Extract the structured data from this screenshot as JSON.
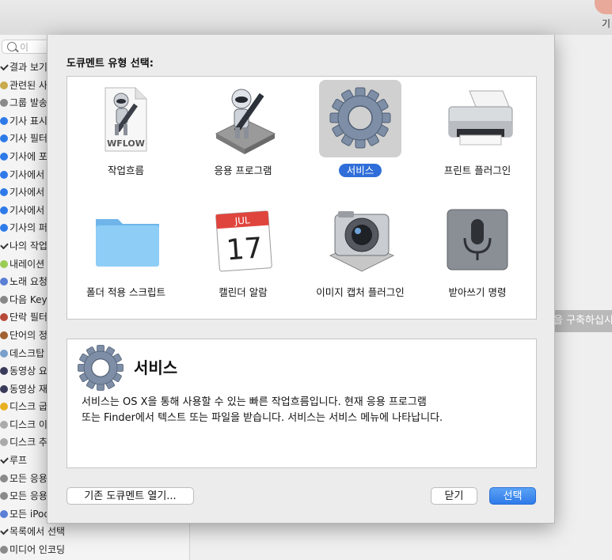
{
  "window": {
    "user_label": "기",
    "search_placeholder": "이",
    "tooltip_text": "을 구축하십시"
  },
  "sidebar": {
    "items": [
      {
        "label": "결과 보기",
        "icon": "check-icon",
        "color": "#333333"
      },
      {
        "label": "관련된 사",
        "icon": "action-icon",
        "color": "#c9a94b"
      },
      {
        "label": "그룹 발송",
        "icon": "action-icon",
        "color": "#8a8a8a"
      },
      {
        "label": "기사 표시",
        "icon": "rss-icon",
        "color": "#2f7ae9"
      },
      {
        "label": "기사 필터",
        "icon": "rss-icon",
        "color": "#2f7ae9"
      },
      {
        "label": "기사에 포",
        "icon": "rss-icon",
        "color": "#2f7ae9"
      },
      {
        "label": "기사에서",
        "icon": "rss-icon",
        "color": "#2f7ae9"
      },
      {
        "label": "기사에서",
        "icon": "rss-icon",
        "color": "#2f7ae9"
      },
      {
        "label": "기사에서",
        "icon": "rss-icon",
        "color": "#2f7ae9"
      },
      {
        "label": "기사의 퍼",
        "icon": "rss-icon",
        "color": "#2f7ae9"
      },
      {
        "label": "나의 작업",
        "icon": "check-icon",
        "color": "#333333"
      },
      {
        "label": "내레이션",
        "icon": "action-icon",
        "color": "#9acd55"
      },
      {
        "label": "노래 요청",
        "icon": "action-icon",
        "color": "#5a7fd6"
      },
      {
        "label": "다음 Key",
        "icon": "action-icon",
        "color": "#888888"
      },
      {
        "label": "단락 필터",
        "icon": "action-icon",
        "color": "#b84a3a"
      },
      {
        "label": "단어의 정",
        "icon": "action-icon",
        "color": "#a06030"
      },
      {
        "label": "데스크탑",
        "icon": "action-icon",
        "color": "#7aa0cc"
      },
      {
        "label": "동영상 요",
        "icon": "action-icon",
        "color": "#3a3a5a"
      },
      {
        "label": "동영상 재",
        "icon": "action-icon",
        "color": "#3a3a5a"
      },
      {
        "label": "디스크 굽",
        "icon": "action-icon",
        "color": "#e8b020"
      },
      {
        "label": "디스크 이",
        "icon": "action-icon",
        "color": "#aaaaaa"
      },
      {
        "label": "디스크 추",
        "icon": "action-icon",
        "color": "#aaaaaa"
      },
      {
        "label": "루프",
        "icon": "check-icon",
        "color": "#333333"
      },
      {
        "label": "모든 응용",
        "icon": "action-icon",
        "color": "#8a8a8a"
      },
      {
        "label": "모든 응용",
        "icon": "action-icon",
        "color": "#8a8a8a"
      },
      {
        "label": "모든 iPod",
        "icon": "action-icon",
        "color": "#5a7fd6"
      },
      {
        "label": "목록에서 선택",
        "icon": "check-icon",
        "color": "#333333"
      },
      {
        "label": "미디어 인코딩",
        "icon": "action-icon",
        "color": "#8a8a8a"
      }
    ]
  },
  "dialog": {
    "heading": "도큐멘트 유형 선택:",
    "types": [
      {
        "label": "작업흐름",
        "icon": "workflow-document-icon",
        "badge": "WFLOW",
        "selected": false
      },
      {
        "label": "응용 프로그램",
        "icon": "automator-robot-icon",
        "selected": false
      },
      {
        "label": "서비스",
        "icon": "gear-icon",
        "selected": true
      },
      {
        "label": "프린트 플러그인",
        "icon": "printer-icon",
        "selected": false
      },
      {
        "label": "폴더 적용 스크립트",
        "icon": "folder-icon",
        "selected": false
      },
      {
        "label": "캘린더 알람",
        "icon": "calendar-icon",
        "month": "JUL",
        "day": "17",
        "selected": false
      },
      {
        "label": "이미지 캡처 플러그인",
        "icon": "camera-icon",
        "selected": false
      },
      {
        "label": "받아쓰기 명령",
        "icon": "microphone-icon",
        "selected": false
      }
    ],
    "description": {
      "title": "서비스",
      "line1": "서비스는 OS X을 통해 사용할 수 있는 빠른 작업흐름입니다. 현재 응용 프로그램",
      "line2": "또는 Finder에서 텍스트 또는 파일을 받습니다. 서비스는 서비스 메뉴에 나타납니다."
    },
    "buttons": {
      "open_existing": "기존 도큐멘트 열기...",
      "close": "닫기",
      "choose": "선택"
    },
    "accent_color": "#2f6ed9"
  }
}
